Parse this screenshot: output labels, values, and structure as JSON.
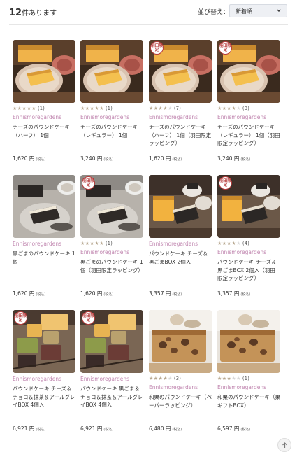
{
  "header": {
    "count_number": "12",
    "count_suffix": "件あります",
    "sort_label": "並び替え：",
    "sort_value": "新着順"
  },
  "products": [
    {
      "image": "cheese-cake",
      "badge": "",
      "stars": 5,
      "rating_count": "(1)",
      "brand": "Ennismoregardens",
      "name": "チーズのパウンドケーキ（ハーフ） 1個",
      "price": "1,620 円",
      "tax": "(税込)"
    },
    {
      "image": "cheese-cake",
      "badge": "",
      "stars": 5,
      "rating_count": "(1)",
      "brand": "Ennismoregardens",
      "name": "チーズのパウンドケーキ（レギュラー） 1個",
      "price": "3,240 円",
      "tax": "(税込)"
    },
    {
      "image": "cheese-cake",
      "badge": "羽田限定",
      "stars": 4,
      "rating_count": "(7)",
      "brand": "Ennismoregardens",
      "name": "チーズのパウンドケーキ（ハーフ） 1個（羽田限定ラッピング）",
      "price": "1,620 円",
      "tax": "(税込)"
    },
    {
      "image": "cheese-cake",
      "badge": "羽田限定",
      "stars": 4,
      "rating_count": "(3)",
      "brand": "Ennismoregardens",
      "name": "チーズのパウンドケーキ（レギュラー） 1個（羽田限定ラッピング）",
      "price": "3,240 円",
      "tax": "(税込)"
    },
    {
      "image": "sesame-cake",
      "badge": "",
      "stars": 0,
      "rating_count": "",
      "brand": "Ennismoregardens",
      "name": "黒ごまのパウンドケーキ 1個",
      "price": "1,620 円",
      "tax": "(税込)"
    },
    {
      "image": "sesame-cake",
      "badge": "羽田限定",
      "stars": 5,
      "rating_count": "(1)",
      "brand": "Ennismoregardens",
      "name": "黒ごまのパウンドケーキ 1個（羽田限定ラッピング）",
      "price": "1,620 円",
      "tax": "(税込)"
    },
    {
      "image": "cheese-sesame-box",
      "badge": "",
      "stars": 0,
      "rating_count": "",
      "brand": "Ennismoregardens",
      "name": "パウンドケーキ チーズ＆黒ごまBOX 2個入",
      "price": "3,357 円",
      "tax": "(税込)"
    },
    {
      "image": "cheese-sesame-box",
      "badge": "羽田限定",
      "stars": 4,
      "rating_count": "(4)",
      "brand": "Ennismoregardens",
      "name": "パウンドケーキ チーズ＆黒ごまBOX 2個入（羽田限定ラッピング）",
      "price": "3,357 円",
      "tax": "(税込)"
    },
    {
      "image": "four-cake-box",
      "badge": "羽田限定",
      "stars": 0,
      "rating_count": "",
      "brand": "Ennismoregardens",
      "name": "パウンドケーキ チーズ＆チョコ＆抹茶＆アールグレイBOX 4個入",
      "price": "6,921 円",
      "tax": "(税込)"
    },
    {
      "image": "four-cake-box",
      "badge": "羽田限定",
      "stars": 0,
      "rating_count": "",
      "brand": "Ennismoregardens",
      "name": "パウンドケーキ 黒ごま＆チョコ＆抹茶＆アールグレイBOX 4個入",
      "price": "6,921 円",
      "tax": "(税込)"
    },
    {
      "image": "chestnut-cake",
      "badge": "",
      "stars": 4,
      "rating_count": "(3)",
      "brand": "Ennismoregardens",
      "name": "和栗のパウンドケーキ（ペーパーラッピング）",
      "price": "6,480 円",
      "tax": "(税込)"
    },
    {
      "image": "chestnut-cake",
      "badge": "",
      "stars": 3,
      "rating_count": "(1)",
      "brand": "Ennismoregardens",
      "name": "和栗のパウンドケーキ（果ギフトBOX）",
      "price": "6,597 円",
      "tax": "(税込)"
    }
  ],
  "icons": {
    "sort_chevron": "chevron-down-icon",
    "scroll_top": "arrow-up-icon"
  },
  "colors": {
    "brand": "#c187b0",
    "star": "#b8a890",
    "badge": "#b63a3a"
  }
}
